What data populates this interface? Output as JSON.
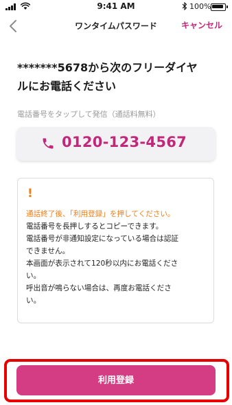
{
  "status_bar": {
    "time": "9:41 AM",
    "battery_percent": "100%",
    "icons": [
      "signal-icon",
      "wifi-icon",
      "bluetooth-icon",
      "battery-icon"
    ]
  },
  "nav": {
    "title": "ワンタイムパスワード",
    "cancel_label": "キャンセル",
    "back_icon": "chevron-left-icon"
  },
  "heading": {
    "line1": "*******5678から次のフリーダイヤ",
    "line2": "ルにお電話ください"
  },
  "tap_instruction": "電話番号をタップして発信（通話料無料）",
  "phone": {
    "icon": "phone-icon",
    "number": "0120-123-4567"
  },
  "notice": {
    "icon": "!",
    "lines": [
      {
        "text": "通話終了後、「利用登録」を押してください。",
        "style": "orange"
      },
      {
        "text": "電話番号を長押しするとコピーできます。",
        "style": "normal"
      },
      {
        "text": "電話番号が非通知設定になっている場合は認証",
        "style": "normal"
      },
      {
        "text": "できません。",
        "style": "normal"
      },
      {
        "text": "本画面が表示されて120秒以内にお電話くださ",
        "style": "normal"
      },
      {
        "text": "い。",
        "style": "normal"
      },
      {
        "text": "呼出音が鳴らない場合は、再度お電話くださ",
        "style": "normal"
      },
      {
        "text": "い。",
        "style": "normal"
      }
    ]
  },
  "register_label": "利用登録",
  "colors": {
    "accent": "#c2287a",
    "button": "#d43c84",
    "warning": "#ef7e1b",
    "highlight": "#e60000"
  }
}
